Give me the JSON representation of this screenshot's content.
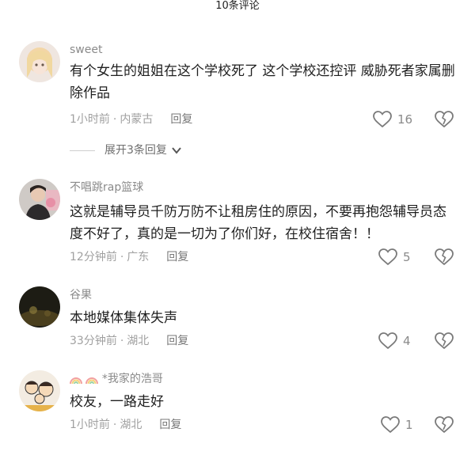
{
  "header": {
    "title": "10条评论"
  },
  "comments": [
    {
      "username": "sweet",
      "text": "有个女生的姐姐在这个学校死了 这个学校还控评 威胁死者家属删除作品",
      "time": "1小时前",
      "location": "内蒙古",
      "reply_label": "回复",
      "likes": "16",
      "expand_label": "展开3条回复",
      "avatar_icon": "avatar-blonde-girl"
    },
    {
      "username": "不唱跳rap篮球",
      "text": "这就是辅导员千防万防不让租房住的原因，不要再抱怨辅导员态度不好了，真的是一切为了你们好，在校住宿舍！！",
      "time": "12分钟前",
      "location": "广东",
      "reply_label": "回复",
      "likes": "5",
      "avatar_icon": "avatar-man-flowers"
    },
    {
      "username": "谷果",
      "text": "本地媒体集体失声",
      "time": "33分钟前",
      "location": "湖北",
      "reply_label": "回复",
      "likes": "4",
      "avatar_icon": "avatar-dark-night"
    },
    {
      "username": "*我家的浩哥",
      "username_prefix_icons": [
        "rainbow-emoji",
        "rainbow-emoji"
      ],
      "text": "校友，一路走好",
      "time": "1小时前",
      "location": "湖北",
      "reply_label": "回复",
      "likes": "1",
      "avatar_icon": "avatar-cartoon-family"
    }
  ],
  "colors": {
    "text": "#1f1f1f",
    "meta": "#a0a0a0",
    "icon": "#8a8a8a"
  }
}
